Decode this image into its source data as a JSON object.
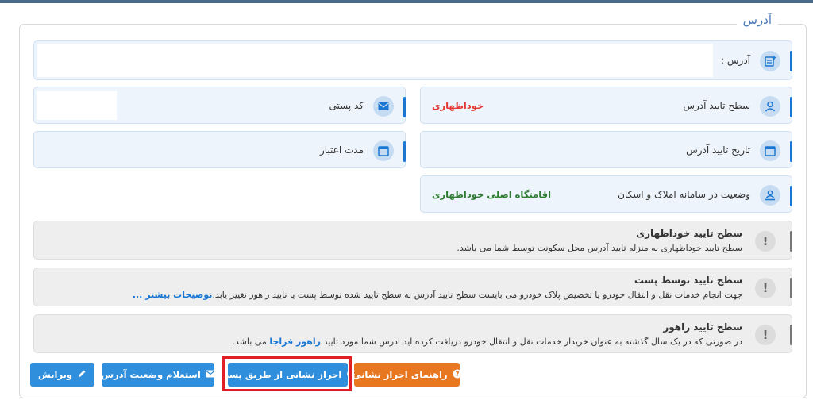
{
  "section": {
    "legend": "آدرس"
  },
  "address": {
    "label": "آدرس :",
    "value": ""
  },
  "postal": {
    "label": "کد پستی",
    "value": ""
  },
  "validity": {
    "label": "مدت اعتبار"
  },
  "level": {
    "label": "سطح تایید آدرس",
    "value": "خوداظهاری",
    "color": "#e53935"
  },
  "confirm_date": {
    "label": "تاریخ تایید آدرس"
  },
  "status": {
    "label": "وضعیت در سامانه املاک و اسکان",
    "value": "اقامتگاه اصلی خوداظهاری",
    "color": "#2e7d32"
  },
  "notes": [
    {
      "title": "سطح تایید خوداظهاری",
      "text": "سطح تایید خوداظهاری به منزله تایید آدرس محل سکونت توسط شما می باشد.",
      "link": ""
    },
    {
      "title": "سطح تایید توسط پست",
      "text": "جهت انجام خدمات نقل و انتقال خودرو یا تخصیص پلاک خودرو می بایست سطح تایید آدرس به سطح تایید شده توسط پست یا تایید راهور تغییر یابد.",
      "link": "توضیحات بیشتر ..."
    },
    {
      "title": "سطح تایید راهور",
      "text_before": "در صورتی که در یک سال گذشته به عنوان خریدار خدمات نقل و انتقال خودرو دریافت کرده اید آدرس شما مورد تایید ",
      "link": "راهور فراجا",
      "text_after": " می باشد."
    }
  ],
  "buttons": {
    "guide": "راهنمای احراز نشانی",
    "verify_post": "احراز نشانی از طریق پست",
    "inquiry": "استعلام وضعیت آدرس",
    "edit": "ویرایش"
  },
  "icons": {
    "address": "address-card-icon",
    "postal": "envelope-icon",
    "validity": "calendar-icon",
    "level": "user-icon",
    "confirm_date": "calendar-icon",
    "status": "user-badge-icon",
    "note": "exclamation-icon",
    "guide": "question-circle-icon",
    "verify_post": "refresh-icon",
    "inquiry": "envelope-icon",
    "edit": "pencil-icon"
  }
}
